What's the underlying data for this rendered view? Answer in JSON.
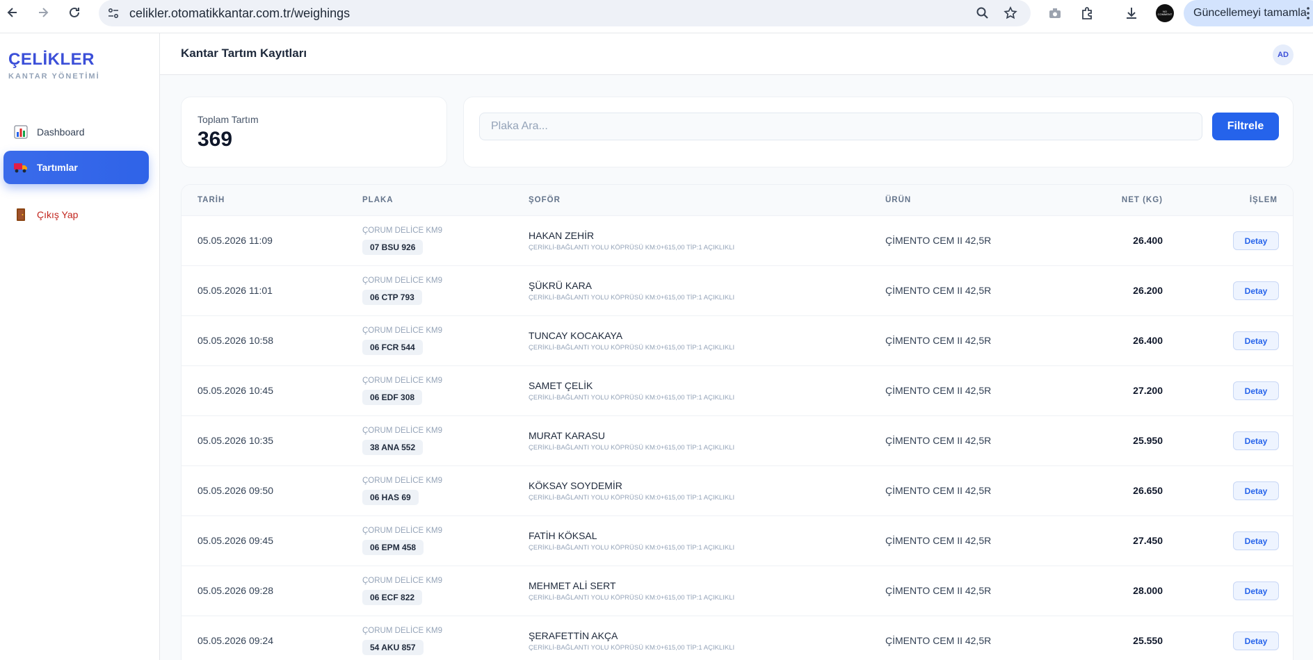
{
  "browser": {
    "url": "celikler.otomatikkantar.com.tr/weighings",
    "update_label": "Güncellemeyi tamamla",
    "profile_label": "NO COMMENT"
  },
  "sidebar": {
    "brand": "ÇELİKLER",
    "brand_sub": "KANTAR YÖNETİMİ",
    "items": [
      {
        "label": "Dashboard",
        "icon": "bar-chart-icon"
      },
      {
        "label": "Tartımlar",
        "icon": "truck-icon",
        "active": true
      },
      {
        "label": "Çıkış Yap",
        "icon": "door-icon"
      }
    ]
  },
  "header": {
    "title": "Kantar Tartım Kayıtları",
    "avatar": "AD"
  },
  "stats": {
    "label": "Toplam Tartım",
    "value": "369"
  },
  "search": {
    "placeholder": "Plaka Ara...",
    "value": "",
    "button": "Filtrele"
  },
  "table": {
    "columns": [
      "TARİH",
      "PLAKA",
      "ŞOFÖR",
      "ÜRÜN",
      "NET (KG)",
      "İŞLEM"
    ],
    "rows": [
      {
        "date": "05.05.2026 11:09",
        "location": "ÇORUM DELİCE KM9",
        "plate": "07 BSU 926",
        "driver": "HAKAN ZEHİR",
        "route": "ÇERİKLİ-BAĞLANTI YOLU KÖPRÜSÜ KM:0+615,00 TİP:1 AÇIKLIKLI",
        "product": "ÇİMENTO CEM II 42,5R",
        "net": "26.400",
        "action": "Detay"
      },
      {
        "date": "05.05.2026 11:01",
        "location": "ÇORUM DELİCE KM9",
        "plate": "06 CTP 793",
        "driver": "ŞÜKRÜ KARA",
        "route": "ÇERİKLİ-BAĞLANTI YOLU KÖPRÜSÜ KM:0+615,00 TİP:1 AÇIKLIKLI",
        "product": "ÇİMENTO CEM II 42,5R",
        "net": "26.200",
        "action": "Detay"
      },
      {
        "date": "05.05.2026 10:58",
        "location": "ÇORUM DELİCE KM9",
        "plate": "06 FCR 544",
        "driver": "TUNCAY KOCAKAYA",
        "route": "ÇERİKLİ-BAĞLANTI YOLU KÖPRÜSÜ KM:0+615,00 TİP:1 AÇIKLIKLI",
        "product": "ÇİMENTO CEM II 42,5R",
        "net": "26.400",
        "action": "Detay"
      },
      {
        "date": "05.05.2026 10:45",
        "location": "ÇORUM DELİCE KM9",
        "plate": "06 EDF 308",
        "driver": "SAMET ÇELİK",
        "route": "ÇERİKLİ-BAĞLANTI YOLU KÖPRÜSÜ KM:0+615,00 TİP:1 AÇIKLIKLI",
        "product": "ÇİMENTO CEM II 42,5R",
        "net": "27.200",
        "action": "Detay"
      },
      {
        "date": "05.05.2026 10:35",
        "location": "ÇORUM DELİCE KM9",
        "plate": "38 ANA 552",
        "driver": "MURAT KARASU",
        "route": "ÇERİKLİ-BAĞLANTI YOLU KÖPRÜSÜ KM:0+615,00 TİP:1 AÇIKLIKLI",
        "product": "ÇİMENTO CEM II 42,5R",
        "net": "25.950",
        "action": "Detay"
      },
      {
        "date": "05.05.2026 09:50",
        "location": "ÇORUM DELİCE KM9",
        "plate": "06 HAS 69",
        "driver": "KÖKSAY SOYDEMİR",
        "route": "ÇERİKLİ-BAĞLANTI YOLU KÖPRÜSÜ KM:0+615,00 TİP:1 AÇIKLIKLI",
        "product": "ÇİMENTO CEM II 42,5R",
        "net": "26.650",
        "action": "Detay"
      },
      {
        "date": "05.05.2026 09:45",
        "location": "ÇORUM DELİCE KM9",
        "plate": "06 EPM 458",
        "driver": "FATİH KÖKSAL",
        "route": "ÇERİKLİ-BAĞLANTI YOLU KÖPRÜSÜ KM:0+615,00 TİP:1 AÇIKLIKLI",
        "product": "ÇİMENTO CEM II 42,5R",
        "net": "27.450",
        "action": "Detay"
      },
      {
        "date": "05.05.2026 09:28",
        "location": "ÇORUM DELİCE KM9",
        "plate": "06 ECF 822",
        "driver": "MEHMET ALİ SERT",
        "route": "ÇERİKLİ-BAĞLANTI YOLU KÖPRÜSÜ KM:0+615,00 TİP:1 AÇIKLIKLI",
        "product": "ÇİMENTO CEM II 42,5R",
        "net": "28.000",
        "action": "Detay"
      },
      {
        "date": "05.05.2026 09:24",
        "location": "ÇORUM DELİCE KM9",
        "plate": "54 AKU 857",
        "driver": "ŞERAFETTİN AKÇA",
        "route": "ÇERİKLİ-BAĞLANTI YOLU KÖPRÜSÜ KM:0+615,00 TİP:1 AÇIKLIKLI",
        "product": "ÇİMENTO CEM II 42,5R",
        "net": "25.550",
        "action": "Detay"
      }
    ]
  },
  "colors": {
    "brand": "#3b4fd8",
    "primary": "#2563eb",
    "logout": "#c2261e"
  }
}
